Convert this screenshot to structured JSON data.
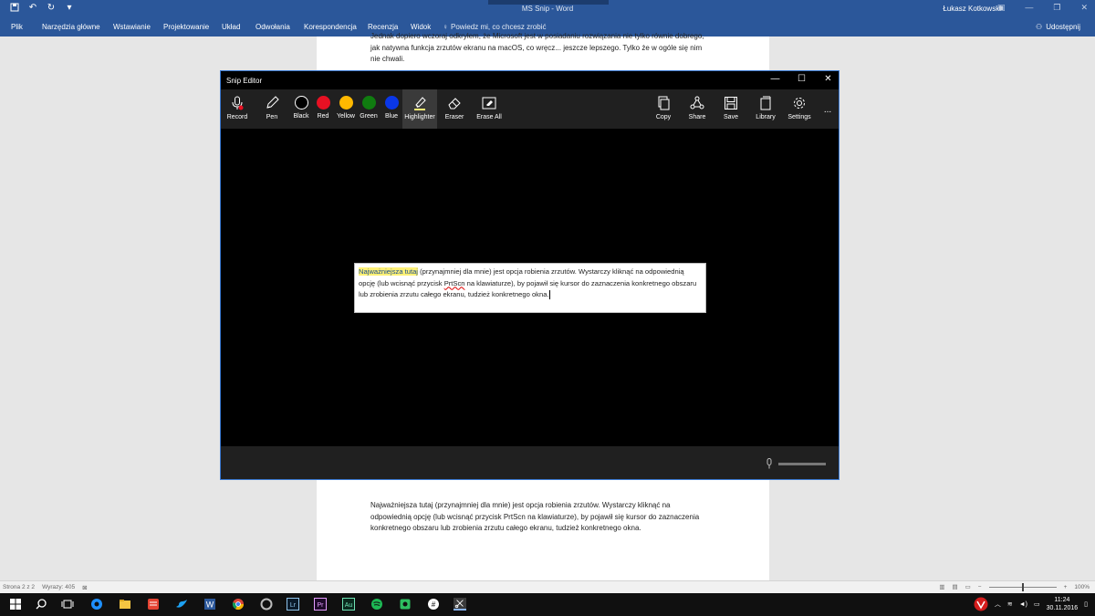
{
  "word": {
    "title": "MS Snip  -  Word",
    "user": "Łukasz Kotkowski",
    "tabs": [
      "Plik",
      "Narzędzia główne",
      "Wstawianie",
      "Projektowanie",
      "Układ",
      "Odwołania",
      "Korespondencja",
      "Recenzja",
      "Widok"
    ],
    "tell_me": "Powiedz mi, co chcesz zrobić",
    "share": "Udostępnij",
    "top_paragraph": "Jednak dopiero wczoraj odkryłem, że Microsoft jest w posiadaniu rozwiązania nie tylko równie dobrego, jak natywna funkcja zrzutów ekranu na macOS, co wręcz... jeszcze lepszego. Tylko że w ogóle się nim nie chwali.",
    "bottom_paragraph": "Najważniejsza tutaj (przynajmniej dla mnie) jest opcja robienia zrzutów. Wystarczy kliknąć na odpowiednią opcję (lub wcisnąć przycisk PrtScn na klawiaturze), by pojawił się kursor do zaznaczenia konkretnego obszaru lub zrobienia zrzutu całego ekranu, tudzież konkretnego okna.",
    "status": {
      "page": "Strona 2 z 2",
      "words": "Wyrazy: 405",
      "zoom": "100%"
    }
  },
  "snip": {
    "title": "Snip Editor",
    "tools_left": [
      {
        "label": "Record",
        "icon": "microphone-icon"
      },
      {
        "label": "Pen",
        "icon": "pen-icon"
      },
      {
        "label": "Black",
        "color": "#000000"
      },
      {
        "label": "Red",
        "color": "#e81123"
      },
      {
        "label": "Yellow",
        "color": "#ffb900"
      },
      {
        "label": "Green",
        "color": "#107c10"
      },
      {
        "label": "Blue",
        "color": "#0a37e8"
      },
      {
        "label": "Highlighter",
        "icon": "highlighter-icon"
      },
      {
        "label": "Eraser",
        "icon": "eraser-icon"
      },
      {
        "label": "Erase All",
        "icon": "erase-all-icon"
      }
    ],
    "tools_right": [
      {
        "label": "Copy",
        "icon": "copy-icon"
      },
      {
        "label": "Share",
        "icon": "share-icon"
      },
      {
        "label": "Save",
        "icon": "save-icon"
      },
      {
        "label": "Library",
        "icon": "library-icon"
      },
      {
        "label": "Settings",
        "icon": "gear-icon"
      }
    ],
    "more": "...",
    "capture": {
      "highlighted": "Najważniejsza tutaj",
      "text_1": " (przynajmniej dla mnie) jest opcja robienia zrzutów. Wystarczy kliknąć na odpowiednią opcję (lub wcisnąć przycisk ",
      "prtscn": "PrtScn",
      "text_2": " na klawiaturze), by pojawił się kursor do zaznaczenia konkretnego obszaru lub zrobienia zrzutu całego ekranu, tudzież konkretnego okna."
    }
  },
  "taskbar": {
    "time": "11:24",
    "date": "30.11.2016"
  }
}
